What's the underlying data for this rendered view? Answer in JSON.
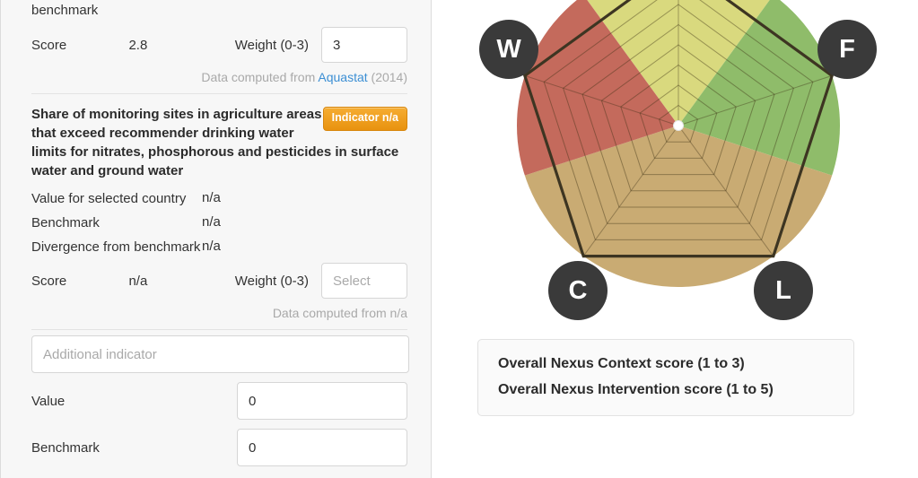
{
  "left_panel": {
    "top_indicator": {
      "divergence_label_cont": "benchmark",
      "score_label": "Score",
      "score_value": "2.8",
      "weight_label": "Weight (0-3)",
      "weight_value": "3",
      "source_prefix": "Data computed from ",
      "source_link": "Aquastat",
      "source_year": " (2014)"
    },
    "indicator": {
      "title": "Share of monitoring sites in agriculture areas that exceed recommender drinking water limits for nitrates, phosphorous and pesticides in surface water and ground water",
      "badge": "Indicator n/a",
      "rows": [
        {
          "label": "Value for selected country",
          "value": "n/a"
        },
        {
          "label": "Benchmark",
          "value": "n/a"
        },
        {
          "label": "Divergence from benchmark",
          "value": "n/a"
        }
      ],
      "score_label": "Score",
      "score_value": "n/a",
      "weight_label": "Weight (0-3)",
      "weight_placeholder": "Select",
      "source_text": "Data computed from n/a"
    },
    "additional": {
      "indicator_placeholder": "Additional indicator",
      "value_label": "Value",
      "value_value": "0",
      "benchmark_label": "Benchmark",
      "benchmark_value": "0"
    }
  },
  "radar": {
    "axes": [
      {
        "key": "top",
        "label": "",
        "show_bubble": false
      },
      {
        "key": "F",
        "label": "F",
        "show_bubble": true
      },
      {
        "key": "L",
        "label": "L",
        "show_bubble": true
      },
      {
        "key": "C",
        "label": "C",
        "show_bubble": true
      },
      {
        "key": "W",
        "label": "W",
        "show_bubble": true
      }
    ],
    "sector_colors": [
      "#d9d97e",
      "#8fbc6a",
      "#c9ab73",
      "#c9ab73",
      "#c46a5c"
    ],
    "ring_count": 8,
    "outline_color": "#3d3522",
    "center_dot_color": "#ffffff"
  },
  "legend": {
    "lines": [
      "Overall Nexus Context score (1 to 3)",
      "Overall Nexus Intervention score (1 to 5)"
    ]
  }
}
